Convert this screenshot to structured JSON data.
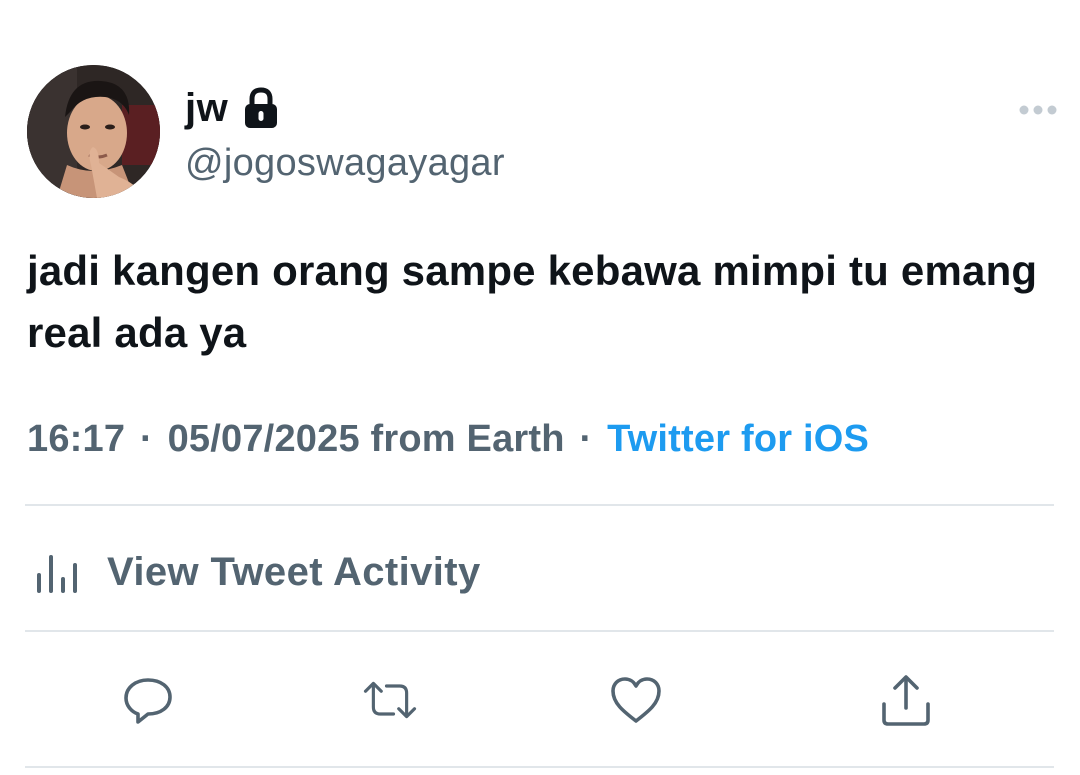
{
  "user": {
    "display_name": "jw",
    "handle": "@jogoswagayagar",
    "protected_icon": "lock-icon",
    "avatar_icon": "avatar"
  },
  "tweet": {
    "text": "jadi kangen orang sampe kebawa mimpi tu emang real ada ya",
    "time": "16:17",
    "date": "05/07/2025",
    "location": "from Earth",
    "separator": "·",
    "source": "Twitter for iOS"
  },
  "activity": {
    "label": "View Tweet Activity",
    "icon": "bar-chart-icon"
  },
  "actions": [
    {
      "name": "reply",
      "icon": "reply-icon"
    },
    {
      "name": "retweet",
      "icon": "retweet-icon"
    },
    {
      "name": "like",
      "icon": "heart-icon"
    },
    {
      "name": "share",
      "icon": "share-icon"
    }
  ],
  "colors": {
    "text_primary": "#0f1419",
    "text_secondary": "#536471",
    "link": "#1d9bf0",
    "divider": "#e1e6ea"
  }
}
